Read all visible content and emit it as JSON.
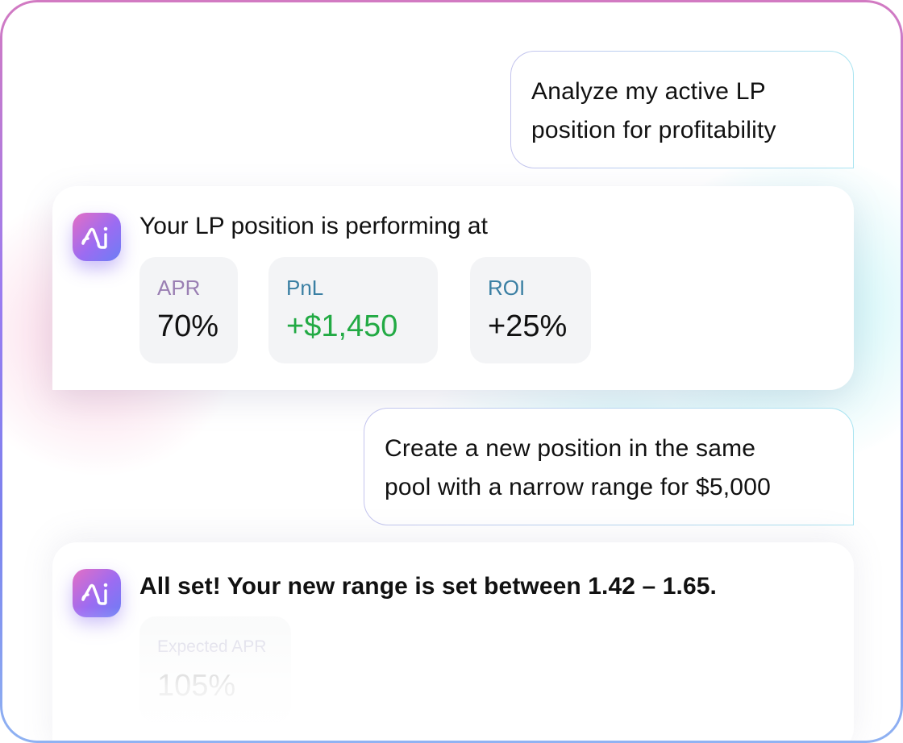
{
  "colors": {
    "apr_label": "#9a7fb3",
    "pnl_label": "#3a7fa3",
    "roi_label": "#3a7fa3",
    "positive": "#22aa44",
    "text": "#111111",
    "expected_label": "#a09cc0"
  },
  "chat": {
    "user_message_1": {
      "line1": "Analyze my active LP",
      "line2": "position for profitability"
    },
    "ai_message_1": {
      "avatar_icon": "ai-logo-icon",
      "text": "Your LP position is performing at",
      "stats": {
        "apr": {
          "label": "APR",
          "value": "70%"
        },
        "pnl": {
          "label": "PnL",
          "value": "+$1,450"
        },
        "roi": {
          "label": "ROI",
          "value": "+25%"
        }
      }
    },
    "user_message_2": {
      "line1": "Create a new position in the same",
      "line2": "pool with a narrow range for $5,000"
    },
    "ai_message_2": {
      "avatar_icon": "ai-logo-icon",
      "text": "All set! Your new range is set between 1.42 – 1.65.",
      "stats": {
        "expected_apr": {
          "label": "Expected APR",
          "value": "105%"
        }
      }
    }
  }
}
